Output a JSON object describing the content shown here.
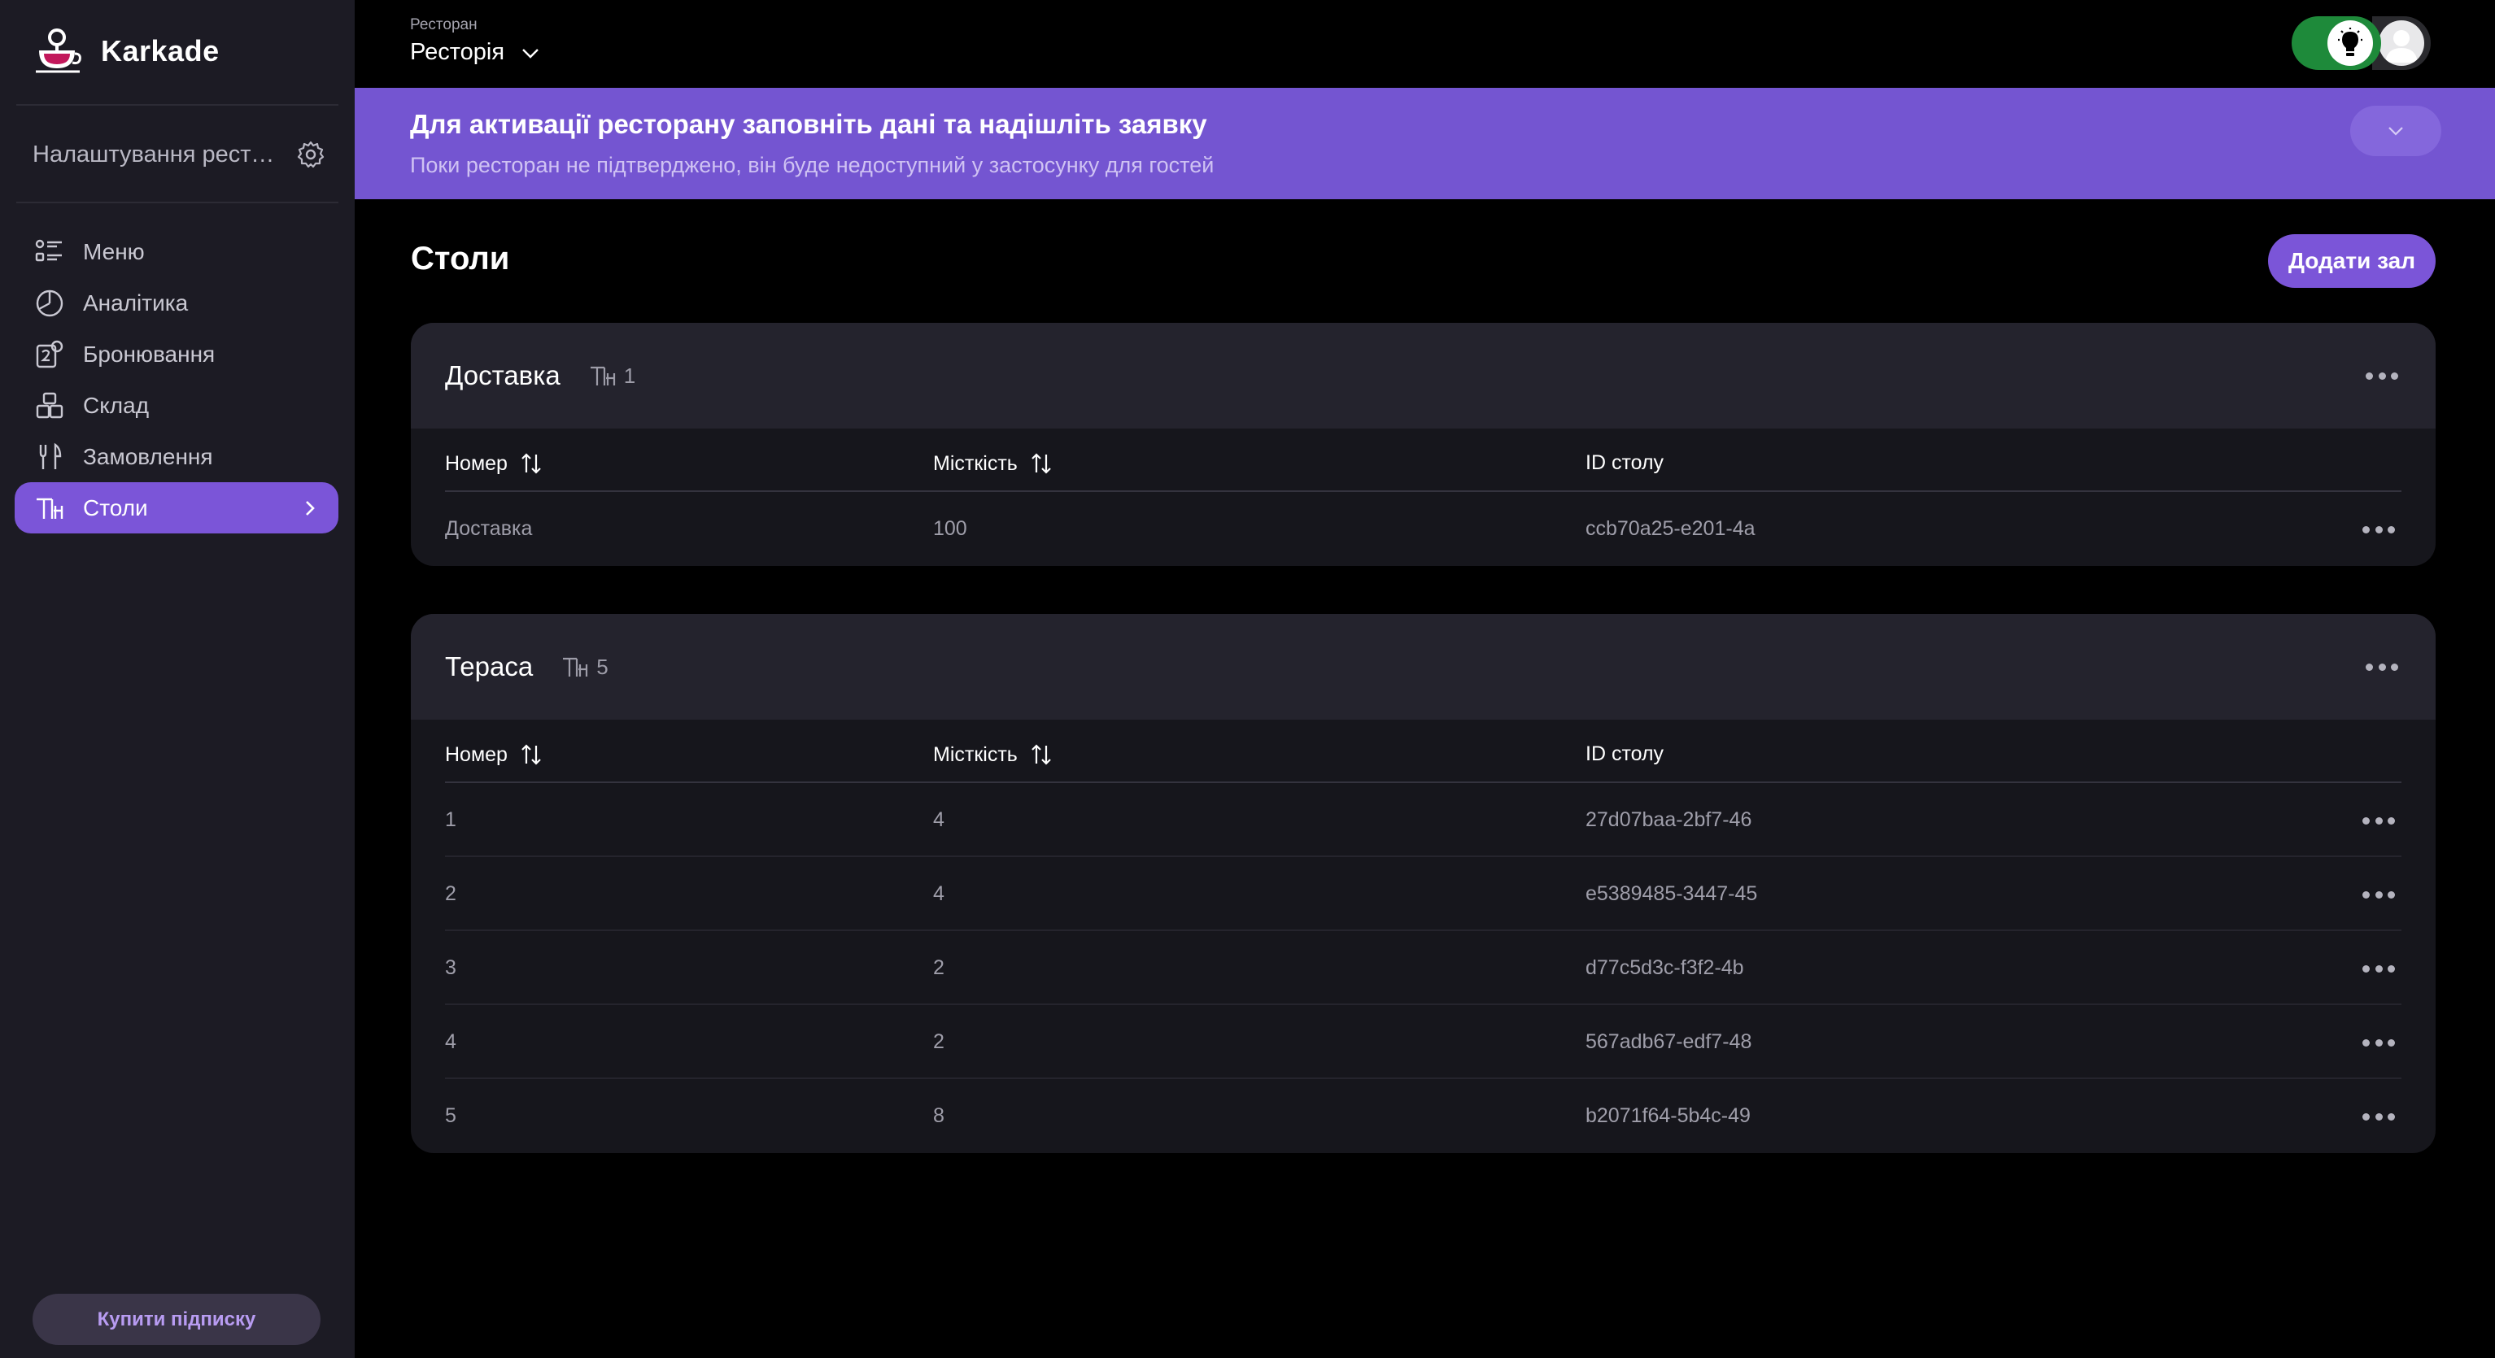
{
  "brand": {
    "name": "Karkade"
  },
  "sidebar": {
    "settings_label": "Налаштування ресторану",
    "items": [
      {
        "label": "Меню",
        "icon": "menu-list-icon"
      },
      {
        "label": "Аналітика",
        "icon": "pie-chart-icon"
      },
      {
        "label": "Бронювання",
        "icon": "booking-icon"
      },
      {
        "label": "Склад",
        "icon": "boxes-icon"
      },
      {
        "label": "Замовлення",
        "icon": "cutlery-icon"
      },
      {
        "label": "Столи",
        "icon": "table-icon",
        "active": true
      }
    ],
    "buy_label": "Купити підписку"
  },
  "topbar": {
    "restaurant_caption": "Ресторан",
    "restaurant_name": "Ресторія"
  },
  "banner": {
    "title": "Для активації ресторану заповніть дані та надішліть заявку",
    "subtitle": "Поки ресторан не підтверджено, він буде недоступний у застосунку для гостей"
  },
  "page": {
    "title": "Столи",
    "add_hall_label": "Додати зал"
  },
  "columns": {
    "number": "Номер",
    "capacity": "Місткість",
    "table_id": "ID столу"
  },
  "halls": [
    {
      "name": "Доставка",
      "count": "1",
      "rows": [
        {
          "number": "Доставка",
          "capacity": "100",
          "id": "ccb70a25-e201-4a"
        }
      ]
    },
    {
      "name": "Тераса",
      "count": "5",
      "rows": [
        {
          "number": "1",
          "capacity": "4",
          "id": "27d07baa-2bf7-46"
        },
        {
          "number": "2",
          "capacity": "4",
          "id": "e5389485-3447-45"
        },
        {
          "number": "3",
          "capacity": "2",
          "id": "d77c5d3c-f3f2-4b"
        },
        {
          "number": "4",
          "capacity": "2",
          "id": "567adb67-edf7-48"
        },
        {
          "number": "5",
          "capacity": "8",
          "id": "b2071f64-5b4c-49"
        }
      ]
    }
  ],
  "colors": {
    "accent": "#7b55d8",
    "banner": "#7455d1",
    "sidebar": "#1c1b24",
    "toggle_on": "#1e8a3a"
  }
}
